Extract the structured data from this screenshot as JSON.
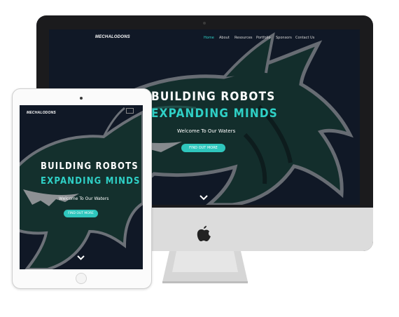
{
  "brand": {
    "logo_text": "MECHALODONS",
    "colors": {
      "accent": "#2fd0c6",
      "background": "#111826",
      "shark_body": "#16382f",
      "shark_outline": "#8b8f93"
    }
  },
  "desktop": {
    "nav": {
      "items": [
        {
          "label": "Home",
          "active": true
        },
        {
          "label": "About",
          "active": false
        },
        {
          "label": "Resources",
          "active": false
        },
        {
          "label": "Portfolio",
          "active": false
        },
        {
          "label": "Sponsors",
          "active": false
        },
        {
          "label": "Contact Us",
          "active": false
        }
      ]
    },
    "hero": {
      "line1": "BUILDING ROBOTS",
      "line2": "EXPANDING MINDS",
      "subtitle": "Welcome To Our Waters",
      "cta_label": "FIND OUT MORE",
      "scroll_icon": "chevron-down-icon"
    },
    "hardware_icon": "apple-logo-icon"
  },
  "tablet": {
    "menu_icon": "hamburger-menu-icon",
    "hero": {
      "line1": "BUILDING ROBOTS",
      "line2": "EXPANDING MINDS",
      "subtitle": "Welcome To Our Waters",
      "cta_label": "FIND OUT MORE",
      "scroll_icon": "chevron-down-icon"
    }
  }
}
